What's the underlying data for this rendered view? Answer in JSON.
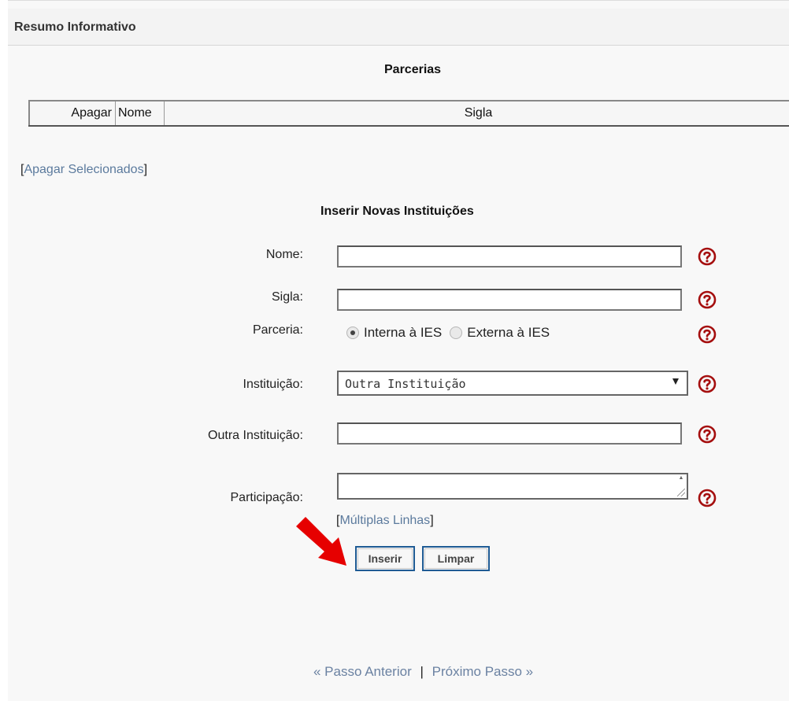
{
  "header": {
    "title": "Resumo Informativo"
  },
  "parcerias": {
    "title": "Parcerias",
    "columns": [
      "Apagar",
      "Nome",
      "Sigla"
    ],
    "delete_selected_link": "Apagar Selecionados"
  },
  "form": {
    "title": "Inserir Novas Instituições",
    "nome": {
      "label": "Nome:",
      "value": ""
    },
    "sigla": {
      "label": "Sigla:",
      "value": ""
    },
    "parceria": {
      "label": "Parceria:",
      "options": [
        "Interna à IES",
        "Externa à IES"
      ],
      "selected": "Interna à IES"
    },
    "instituicao": {
      "label": "Instituição:",
      "selected": "Outra Instituição"
    },
    "outra_instituicao": {
      "label": "Outra Instituição:",
      "value": ""
    },
    "participacao": {
      "label": "Participação:",
      "value": "",
      "multiline_link": "Múltiplas Linhas"
    },
    "buttons": {
      "insert": "Inserir",
      "clear": "Limpar"
    }
  },
  "help_icon": {
    "name": "help-icon",
    "color": "#a50f0f"
  },
  "annotation": {
    "arrow_color": "#e60000"
  },
  "navigation": {
    "previous": "« Passo Anterior",
    "separator": "|",
    "next": "Próximo Passo »"
  }
}
